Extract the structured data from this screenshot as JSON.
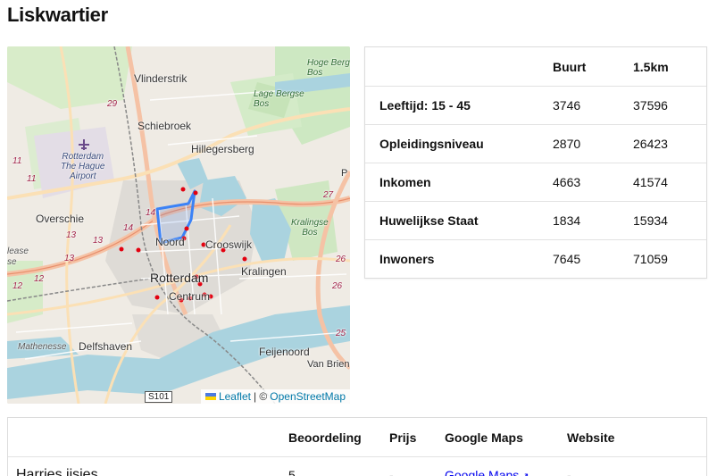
{
  "page": {
    "title": "Liskwartier"
  },
  "map": {
    "labels": {
      "vlinderstrik": "Vlinderstrik",
      "schiebroek": "Schiebroek",
      "hillegersberg": "Hillegersberg",
      "airport": "Rotterdam\nThe Hague\nAirport",
      "overschie": "Overschie",
      "noord": "Noord",
      "crooswijk": "Crooswijk",
      "kralingen": "Kralingen",
      "rotterdam": "Rotterdam",
      "centrum": "Centrum",
      "delfshaven": "Delfshaven",
      "mathenesse": "Mathenesse",
      "feijenoord": "Feijenoord",
      "van_brienen": "Van Brienen",
      "hoge_bergse_bos": "Hoge Berg\nBos",
      "lage_bergse_bos": "Lage Bergse\nBos",
      "kralingse_bos": "Kralingse\nBos",
      "lease": "lease",
      "se": "se"
    },
    "road_numbers": [
      "29",
      "11",
      "11",
      "13",
      "14",
      "14",
      "13",
      "13",
      "12",
      "12",
      "27",
      "26",
      "26",
      "25",
      "P"
    ],
    "road_sign": "S101",
    "attribution": {
      "leaflet": "Leaflet",
      "separator": "| ©",
      "osm": "OpenStreetMap"
    }
  },
  "stats": {
    "headers": [
      "",
      "Buurt",
      "1.5km"
    ],
    "rows": [
      {
        "label": "Leeftijd: 15 - 45",
        "buurt": "3746",
        "km": "37596"
      },
      {
        "label": "Opleidingsniveau",
        "buurt": "2870",
        "km": "26423"
      },
      {
        "label": "Inkomen",
        "buurt": "4663",
        "km": "41574"
      },
      {
        "label": "Huwelijkse Staat",
        "buurt": "1834",
        "km": "15934"
      },
      {
        "label": "Inwoners",
        "buurt": "7645",
        "km": "71059"
      }
    ]
  },
  "places": {
    "headers": [
      "",
      "Beoordeling",
      "Prijs",
      "Google Maps",
      "Website"
    ],
    "rows": [
      {
        "name": "Harries ijsjes",
        "rating": "5",
        "price": "-",
        "maps_link": "Google Maps",
        "website": "-"
      }
    ]
  },
  "colors": {
    "highlight": "#3b82f6",
    "marker": "#e3000f",
    "link": "#0000ee"
  }
}
